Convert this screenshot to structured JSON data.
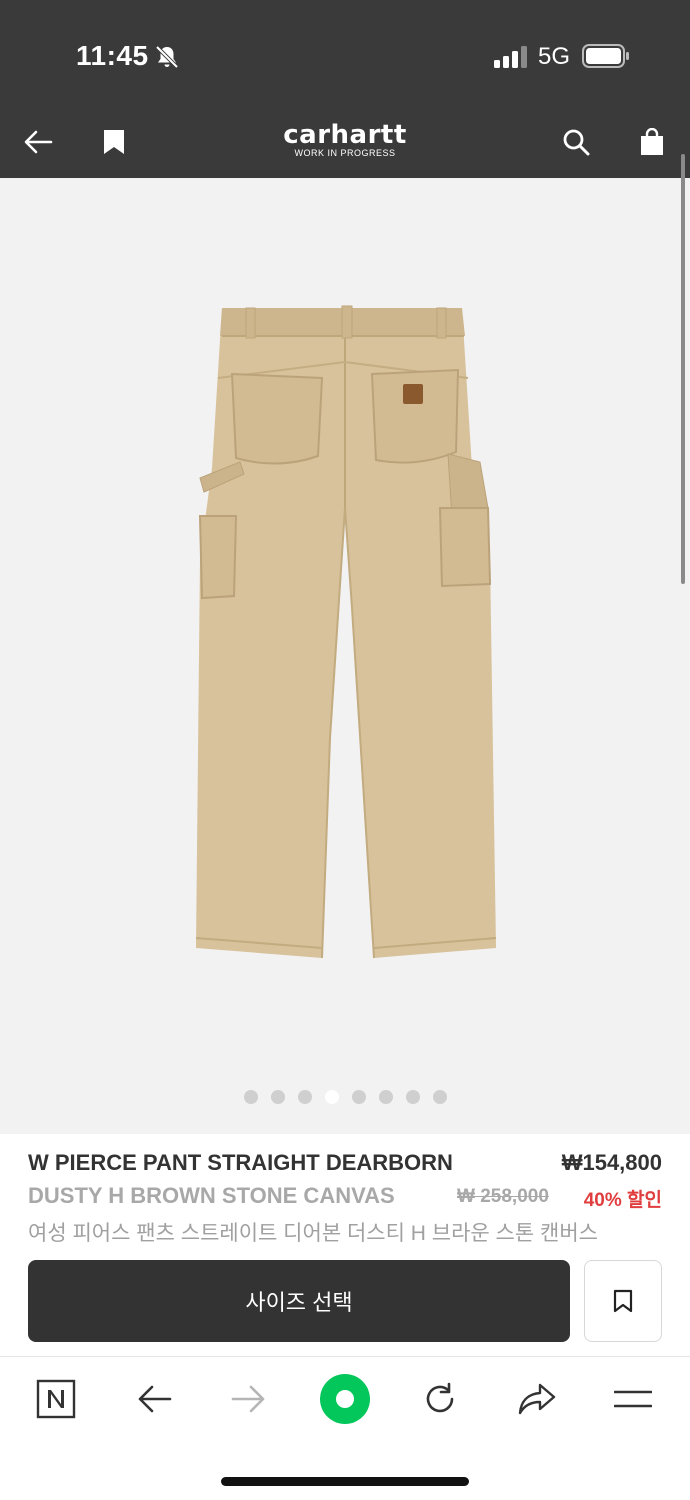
{
  "status_bar": {
    "time": "11:45",
    "network": "5G",
    "icons": [
      "bell-slash-icon",
      "signal-icon",
      "battery-icon"
    ]
  },
  "nav": {
    "logo_main": "carhartt",
    "logo_sub": "WORK IN PROGRESS",
    "icons": [
      "back-arrow-icon",
      "bookmark-icon",
      "search-icon",
      "shopping-bag-icon"
    ]
  },
  "gallery": {
    "image_count": 8,
    "active_index": 3
  },
  "product": {
    "name_line1": "W PIERCE PANT STRAIGHT DEARBORN",
    "name_line2": "DUSTY H BROWN STONE CANVAS",
    "price": "₩154,800",
    "original_price": "₩ 258,000",
    "discount": "40% 할인",
    "korean_name": "여성 피어스 팬츠 스트레이트 디어본 더스티 H 브라운 스톤 캔버스"
  },
  "actions": {
    "size_select_label": "사이즈 선택"
  },
  "browser_bar": {
    "icons": [
      "naver-n-icon",
      "back-icon",
      "forward-icon",
      "green-circle-icon",
      "refresh-icon",
      "share-icon",
      "menu-icon"
    ]
  },
  "colors": {
    "header_bg": "#3a3a3a",
    "image_bg": "#f2f2f2",
    "discount_red": "#e03e3e",
    "button_dark": "#333333",
    "brand_green": "#03c75a",
    "pant_khaki": "#d8c29b"
  }
}
